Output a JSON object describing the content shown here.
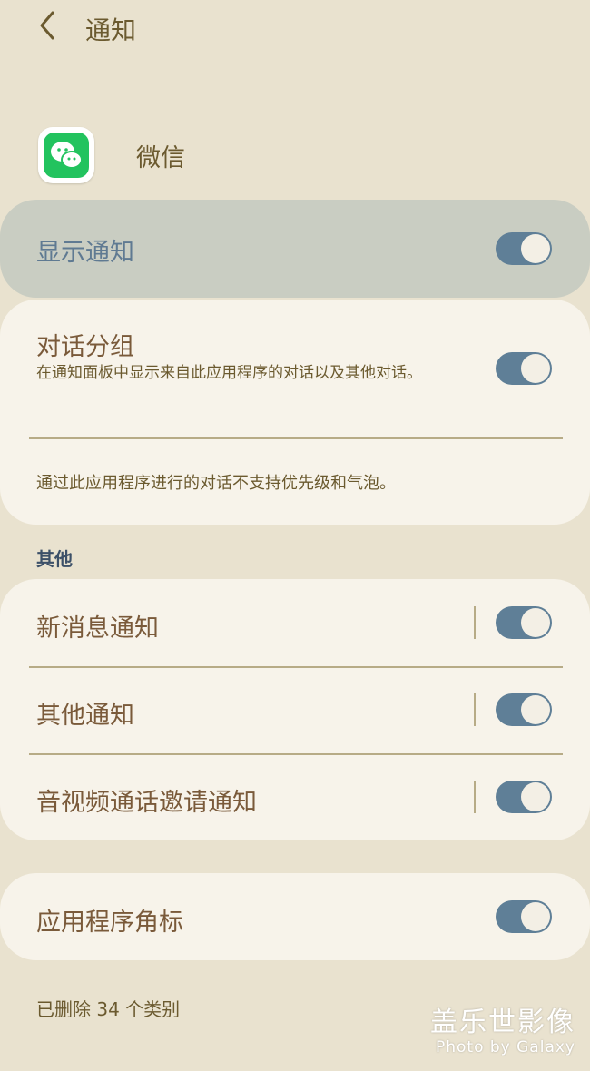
{
  "header": {
    "title": "通知"
  },
  "app": {
    "name": "微信",
    "icon": "wechat-icon",
    "icon_color": "#22c35e"
  },
  "master_toggle": {
    "label": "显示通知",
    "on": true
  },
  "conversation": {
    "title": "对话分组",
    "subtitle": "在通知面板中显示来自此应用程序的对话以及其他对话。",
    "on": true,
    "note": "通过此应用程序进行的对话不支持优先级和气泡。"
  },
  "other_section": {
    "header": "其他",
    "items": [
      {
        "label": "新消息通知",
        "on": true
      },
      {
        "label": "其他通知",
        "on": true
      },
      {
        "label": "音视频通话邀请通知",
        "on": true
      }
    ]
  },
  "badge": {
    "label": "应用程序角标",
    "on": true
  },
  "footer": {
    "deleted_text": "已删除 34 个类别"
  },
  "watermark": {
    "main": "盖乐世影像",
    "sub": "Photo by Galaxy"
  },
  "colors": {
    "background": "#e9e2cf",
    "card": "#f7f3ea",
    "master_bg": "#c9cdc2",
    "toggle_on": "#5f7f97",
    "accent_text": "#5f7a92"
  }
}
